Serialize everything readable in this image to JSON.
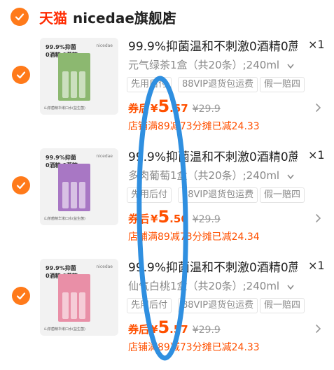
{
  "store": {
    "platform": "天猫",
    "name": "nicedae旗舰店",
    "accent_color": "#ff5000",
    "check_color": "#ff7a1a"
  },
  "items": [
    {
      "thumb_text": "99.9%抑菌\n0酒精 0蔗糖",
      "thumb_brand": "nicedae",
      "thumb_foot": "山茶菌精华漱口水(益生菌)",
      "box_color": "#8cb870",
      "title": "99.9%抑菌温和不刺激0酒精0蔗",
      "quantity": "×1",
      "sku": "元气绿茶1盒（共20条）;240ml",
      "tags": [
        "先用后付",
        "88VIP退货包运费",
        "假一赔四"
      ],
      "price_prefix": "券后",
      "currency": "¥",
      "price_int": "5",
      "price_dec": ".57",
      "original_price": "¥29.9",
      "promo": "店铺满89减73分摊已减24.33"
    },
    {
      "thumb_text": "99.9%抑菌\n0酒精 0蔗糖",
      "thumb_brand": "nicedae",
      "thumb_foot": "山茶菌精华漱口水(益生菌)",
      "box_color": "#a877c4",
      "title": "99.9%抑菌温和不刺激0酒精0蔗",
      "quantity": "×1",
      "sku": "多肉葡萄1盒（共20条）;240ml",
      "tags": [
        "先用后付",
        "88VIP退货包运费",
        "假一赔四"
      ],
      "price_prefix": "券后",
      "currency": "¥",
      "price_int": "5",
      "price_dec": ".56",
      "original_price": "¥29.9",
      "promo": "店铺满89减73分摊已减24.34"
    },
    {
      "thumb_text": "99.9%抑菌\n0酒精 0蔗糖",
      "thumb_brand": "nicedae",
      "thumb_foot": "山茶菌精华漱口水(益生菌)",
      "box_color": "#e98fa7",
      "title": "99.9%抑菌温和不刺激0酒精0蔗",
      "quantity": "×1",
      "sku": "仙气白桃1盒（共20条）;240ml",
      "tags": [
        "先用后付",
        "88VIP退货包运费",
        "假一赔四"
      ],
      "price_prefix": "券后",
      "currency": "¥",
      "price_int": "5",
      "price_dec": ".57",
      "original_price": "¥29.9",
      "promo": "店铺满89减73分摊已减24.33"
    }
  ],
  "annotation_color": "#2f8fe0"
}
